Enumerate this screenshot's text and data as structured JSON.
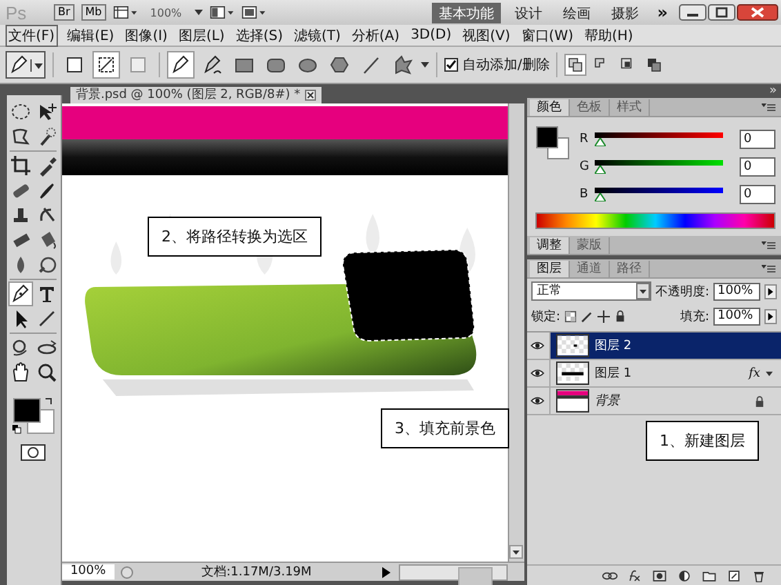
{
  "app_bar": {
    "logo": "Ps",
    "bridge": "Br",
    "mini_bridge": "Mb",
    "zoom": "100%",
    "workspaces": [
      {
        "label": "基本功能",
        "selected": true
      },
      {
        "label": "设计",
        "selected": false
      },
      {
        "label": "绘画",
        "selected": false
      },
      {
        "label": "摄影",
        "selected": false
      }
    ],
    "more": "»"
  },
  "menu": [
    {
      "label": "文件(F)",
      "selected": true
    },
    {
      "label": "编辑(E)",
      "selected": false
    },
    {
      "label": "图像(I)",
      "selected": false
    },
    {
      "label": "图层(L)",
      "selected": false
    },
    {
      "label": "选择(S)",
      "selected": false
    },
    {
      "label": "滤镜(T)",
      "selected": false
    },
    {
      "label": "分析(A)",
      "selected": false
    },
    {
      "label": "3D(D)",
      "selected": false
    },
    {
      "label": "视图(V)",
      "selected": false
    },
    {
      "label": "窗口(W)",
      "selected": false
    },
    {
      "label": "帮助(H)",
      "selected": false
    }
  ],
  "options_bar": {
    "modes": [
      {
        "selected": false
      },
      {
        "selected": true
      },
      {
        "selected": false
      }
    ],
    "tools": [
      {
        "selected": true
      },
      {
        "selected": false
      },
      {
        "selected": false
      },
      {
        "selected": false
      },
      {
        "selected": false
      },
      {
        "selected": false
      },
      {
        "selected": false
      },
      {
        "selected": false
      }
    ],
    "auto_add_delete": {
      "label": "自动添加/删除",
      "checked": true
    },
    "path_ops": [
      {
        "selected": true
      },
      {
        "selected": false
      },
      {
        "selected": false
      },
      {
        "selected": false
      }
    ]
  },
  "toolbox": [
    {
      "selected": false
    },
    {
      "selected": false
    },
    {
      "selected": false
    },
    {
      "selected": false
    },
    {
      "selected": false
    },
    {
      "selected": false
    },
    {
      "selected": false
    },
    {
      "selected": false
    },
    {
      "selected": false
    },
    {
      "selected": false
    },
    {
      "selected": false
    },
    {
      "selected": false
    },
    {
      "selected": false
    },
    {
      "selected": false
    },
    {
      "selected": true
    },
    {
      "selected": false
    },
    {
      "selected": false
    },
    {
      "selected": false
    },
    {
      "selected": false
    },
    {
      "selected": false
    },
    {
      "selected": false
    },
    {
      "selected": false
    }
  ],
  "document": {
    "tab": "背景.psd @ 100% (图层 2, RGB/8#) *",
    "zoom": "100%",
    "doc_info": "文档:1.17M/3.19M"
  },
  "callouts": [
    "2、将路径转换为选区",
    "3、填充前景色",
    "1、新建图层"
  ],
  "color_panel": {
    "tabs": [
      {
        "label": "颜色",
        "selected": true
      },
      {
        "label": "色板",
        "selected": false
      },
      {
        "label": "样式",
        "selected": false
      }
    ],
    "channels": [
      {
        "name": "R",
        "level": 0,
        "value": "0"
      },
      {
        "name": "G",
        "level": 0,
        "value": "0"
      },
      {
        "name": "B",
        "level": 0,
        "value": "0"
      }
    ]
  },
  "adjust_panel": {
    "tabs": [
      {
        "label": "调整",
        "selected": true
      },
      {
        "label": "蒙版",
        "selected": false
      }
    ]
  },
  "layers_panel": {
    "tabs": [
      {
        "label": "图层",
        "selected": true
      },
      {
        "label": "通道",
        "selected": false
      },
      {
        "label": "路径",
        "selected": false
      }
    ],
    "blend_mode": "正常",
    "opacity_label": "不透明度:",
    "opacity": "100%",
    "lock_label": "锁定:",
    "fill_label": "填充:",
    "fill": "100%",
    "layers": [
      {
        "name": "图层 2",
        "selected": true,
        "locked": false
      },
      {
        "name": "图层 1",
        "selected": false,
        "locked": false,
        "effects": "fx"
      },
      {
        "name": "背景",
        "selected": false,
        "locked": true
      }
    ]
  }
}
